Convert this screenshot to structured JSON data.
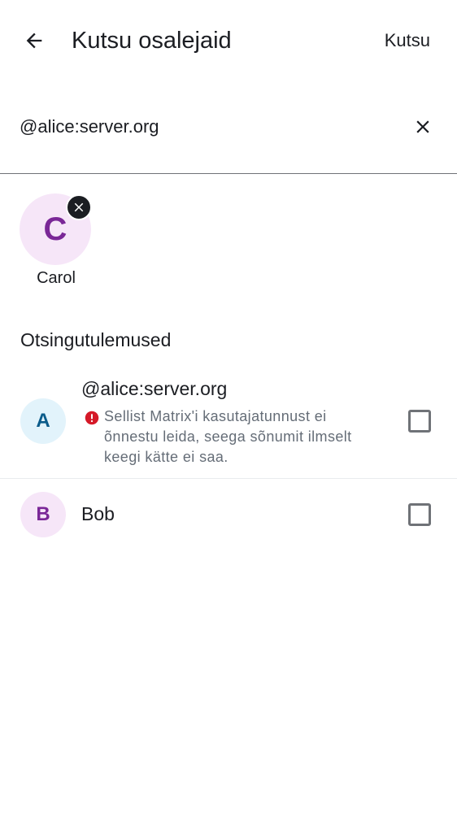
{
  "header": {
    "title": "Kutsu osalejaid",
    "action_label": "Kutsu",
    "back_icon": "arrow-back-icon"
  },
  "search": {
    "value": "@alice:server.org",
    "clear_icon": "close-icon"
  },
  "selected": [
    {
      "initial": "C",
      "name": "Carol",
      "avatar_color": "#f6e6f8",
      "initial_color": "#7a2797",
      "remove_icon": "close-icon"
    }
  ],
  "results": {
    "section_title": "Otsingutulemused",
    "items": [
      {
        "initial": "A",
        "title": "@alice:server.org",
        "warning": "Sellist Matrix'i kasutajatunnust ei õnnestu leida, seega sõnumit ilmselt keegi kätte ei saa.",
        "warning_icon": "error-icon",
        "warning_color": "#d51928",
        "avatar_color": "#e2f3fb",
        "initial_color": "#0a5b8a",
        "checked": false
      },
      {
        "initial": "B",
        "title": "Bob",
        "avatar_color": "#f6e6f8",
        "initial_color": "#7a2797",
        "checked": false
      }
    ]
  }
}
